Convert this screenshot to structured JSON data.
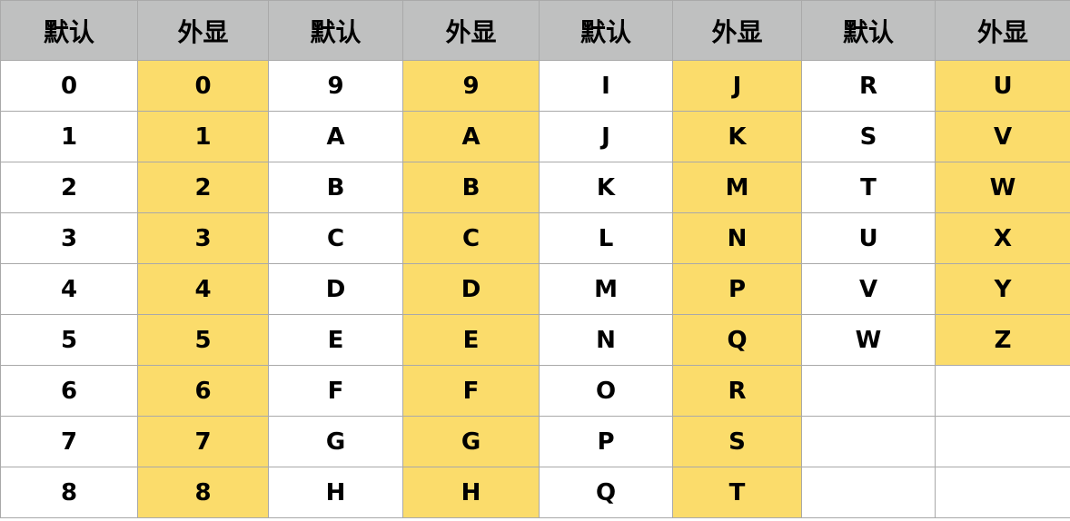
{
  "headers": [
    "默认",
    "外显",
    "默认",
    "外显",
    "默认",
    "外显",
    "默认",
    "外显"
  ],
  "rows": [
    [
      "0",
      "0",
      "9",
      "9",
      "I",
      "J",
      "R",
      "U"
    ],
    [
      "1",
      "1",
      "A",
      "A",
      "J",
      "K",
      "S",
      "V"
    ],
    [
      "2",
      "2",
      "B",
      "B",
      "K",
      "M",
      "T",
      "W"
    ],
    [
      "3",
      "3",
      "C",
      "C",
      "L",
      "N",
      "U",
      "X"
    ],
    [
      "4",
      "4",
      "D",
      "D",
      "M",
      "P",
      "V",
      "Y"
    ],
    [
      "5",
      "5",
      "E",
      "E",
      "N",
      "Q",
      "W",
      "Z"
    ],
    [
      "6",
      "6",
      "F",
      "F",
      "O",
      "R",
      "",
      ""
    ],
    [
      "7",
      "7",
      "G",
      "G",
      "P",
      "S",
      "",
      ""
    ],
    [
      "8",
      "8",
      "H",
      "H",
      "Q",
      "T",
      "",
      ""
    ]
  ],
  "colors": {
    "header_bg": "#bfc0c0",
    "display_bg": "#fbdc6b",
    "default_bg": "#ffffff",
    "grid_line": "#a9a9a9"
  }
}
